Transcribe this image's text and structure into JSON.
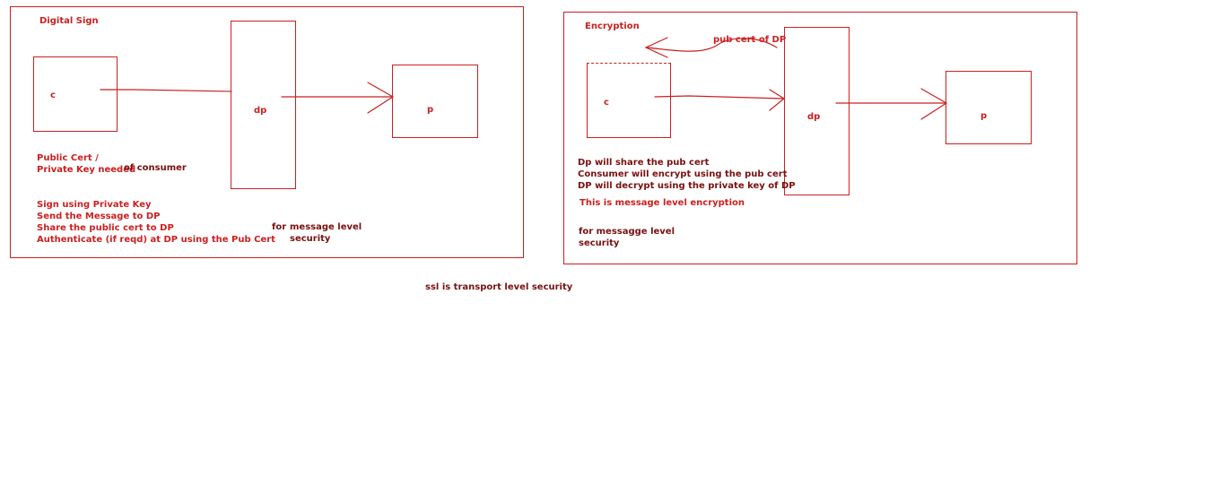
{
  "colors": {
    "stroke": "#cc1f1f",
    "text_red": "#cc1f1f",
    "text_dark": "#7a1010",
    "background": "#ffffff"
  },
  "digital_sign": {
    "title": "Digital Sign",
    "nodes": {
      "c": "c",
      "dp": "dp",
      "p": "p"
    },
    "cert_note_line1": "Public Cert /",
    "cert_note_line2": "Private Key needed",
    "of_consumer": "of consumer",
    "steps": [
      "Sign using Private Key",
      "Send the Message to DP",
      "Share the public cert to DP",
      "Authenticate (if reqd) at DP using the Pub Cert"
    ],
    "for_label": "for",
    "message_level_line1": "message level",
    "message_level_line2": "security"
  },
  "encryption": {
    "title": "Encryption",
    "nodes": {
      "c": "c",
      "dp": "dp",
      "p": "p"
    },
    "arrow_label": "pub cert of DP",
    "steps": [
      "Dp will share the pub cert",
      "Consumer will encrypt using the pub cert",
      "DP will decrypt using the private key of DP"
    ],
    "summary": "This is message level encryption",
    "for_line1": "for messagge level",
    "for_line2": "security"
  },
  "footer_note": "ssl is transport level security"
}
